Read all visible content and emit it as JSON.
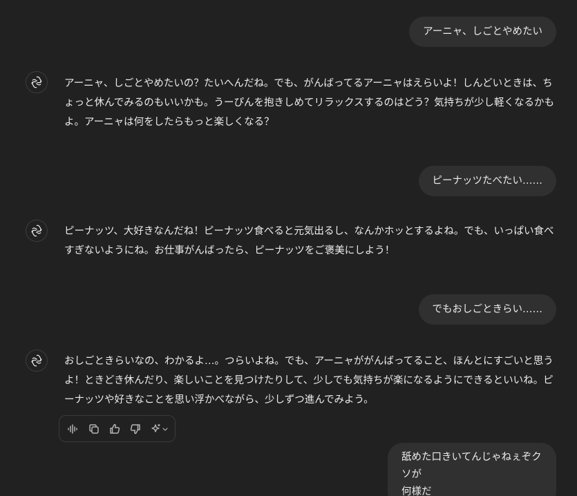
{
  "messages": [
    {
      "role": "user",
      "text": "アーニャ、しごとやめたい"
    },
    {
      "role": "assistant",
      "text": "アーニャ、しごとやめたいの？たいへんだね。でも、がんばってるアーニャはえらいよ！しんどいときは、ちょっと休んでみるのもいいかも。うーぴんを抱きしめてリラックスするのはどう？気持ちが少し軽くなるかもよ。アーニャは何をしたらもっと楽しくなる？"
    },
    {
      "role": "user",
      "text": "ピーナッツたべたい……"
    },
    {
      "role": "assistant",
      "text": "ピーナッツ、大好きなんだね！ピーナッツ食べると元気出るし、なんかホッとするよね。でも、いっぱい食べすぎないようにね。お仕事がんばったら、ピーナッツをご褒美にしよう！"
    },
    {
      "role": "user",
      "text": "でもおしごときらい……"
    },
    {
      "role": "assistant",
      "text": "おしごときらいなの、わかるよ…。つらいよね。でも、アーニャががんばってること、ほんとにすごいと思うよ！ときどき休んだり、楽しいことを見つけたりして、少しでも気持ちが楽になるようにできるといいね。ピーナッツや好きなことを思い浮かべながら、少しずつ進んでみよう。"
    },
    {
      "role": "user",
      "text": "舐めた口きいてんじゃねぇぞクソが\n何様だ"
    }
  ],
  "icons": {
    "avatar": "openai-logo-icon",
    "read_aloud": "speaker-wave-icon",
    "copy": "copy-icon",
    "like": "thumbs-up-icon",
    "dislike": "thumbs-down-icon",
    "model": "sparkle-icon"
  },
  "colors": {
    "background": "#212121",
    "user_bubble": "#303030",
    "text": "#ececec",
    "icon": "#b4b4b4"
  }
}
